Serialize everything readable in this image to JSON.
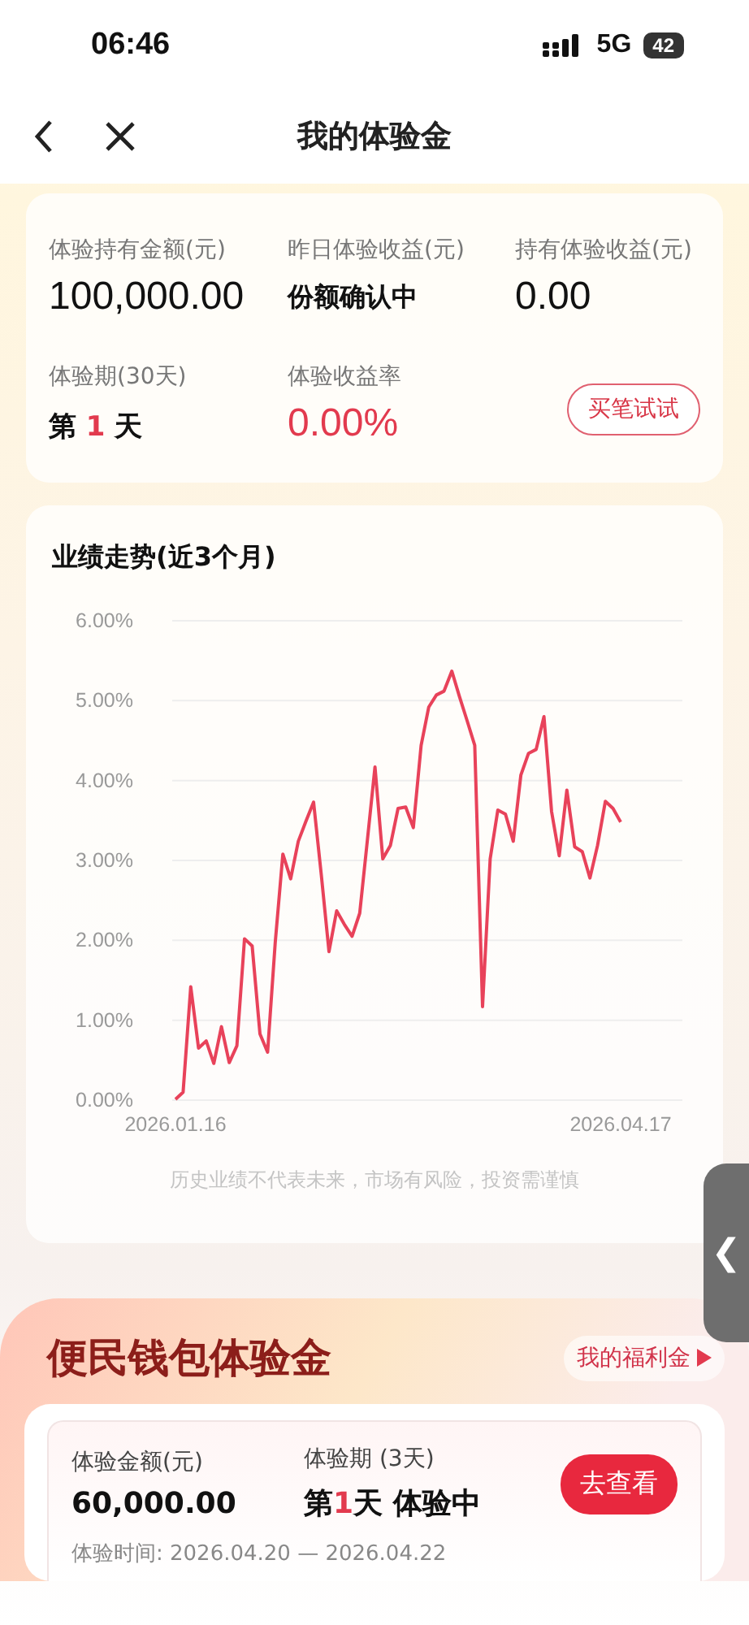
{
  "status_bar": {
    "time": "06:46",
    "network": "5G",
    "battery": "42"
  },
  "nav": {
    "title": "我的体验金"
  },
  "summary": {
    "stats": [
      {
        "label": "体验持有金额(元)",
        "value": "100,000.00",
        "kind": "amount"
      },
      {
        "label": "昨日体验收益(元)",
        "value": "份额确认中",
        "kind": "status"
      },
      {
        "label": "持有体验收益(元)",
        "value": "0.00",
        "kind": "amount"
      },
      {
        "label": "体验期(30天)",
        "value": {
          "prefix": "第",
          "number": "1",
          "suffix": "天"
        },
        "kind": "day"
      },
      {
        "label": "体验收益率",
        "value": "0.00%",
        "kind": "rate"
      }
    ],
    "button": "买笔试试"
  },
  "performance": {
    "title": "业绩走势(近3个月)",
    "chart_data": {
      "type": "line",
      "categories": [
        "2026.01.16",
        null,
        null,
        null,
        null,
        null,
        null,
        null,
        null,
        null,
        null,
        null,
        null,
        null,
        null,
        null,
        null,
        null,
        null,
        null,
        null,
        null,
        null,
        null,
        null,
        null,
        null,
        null,
        null,
        null,
        null,
        null,
        null,
        null,
        null,
        null,
        null,
        null,
        null,
        null,
        null,
        null,
        null,
        null,
        null,
        null,
        null,
        null,
        null,
        null,
        null,
        null,
        null,
        null,
        null,
        null,
        null,
        null,
        "2026.04.17"
      ],
      "series": [
        {
          "color": "#e8425a",
          "values": [
            0.01,
            0.1,
            1.42,
            0.65,
            0.74,
            0.46,
            0.92,
            0.47,
            0.68,
            2.02,
            1.93,
            0.83,
            0.6,
            1.97,
            3.08,
            2.77,
            3.24,
            3.49,
            3.73,
            2.81,
            1.86,
            2.37,
            2.2,
            2.05,
            2.34,
            3.25,
            4.17,
            3.02,
            3.19,
            3.65,
            3.67,
            3.41,
            4.44,
            4.92,
            5.07,
            5.12,
            5.37,
            5.05,
            4.75,
            4.44,
            1.17,
            3.02,
            3.63,
            3.58,
            3.24,
            4.07,
            4.34,
            4.39,
            4.8,
            3.61,
            3.06,
            3.88,
            3.17,
            3.11,
            2.78,
            3.19,
            3.74,
            3.65,
            3.48
          ]
        }
      ],
      "ylim": [
        0,
        6
      ],
      "grid": true,
      "yticks": [
        {
          "value": 0,
          "label": "0.00%"
        },
        {
          "value": 1,
          "label": "1.00%"
        },
        {
          "value": 2,
          "label": "2.00%"
        },
        {
          "value": 3,
          "label": "3.00%"
        },
        {
          "value": 4,
          "label": "4.00%"
        },
        {
          "value": 5,
          "label": "5.00%"
        },
        {
          "value": 6,
          "label": "6.00%"
        }
      ]
    },
    "disclaimer": "历史业绩不代表未来，市场有风险，投资需谨慎"
  },
  "side_tab": {
    "icon": "❮"
  },
  "wallet": {
    "title": "便民钱包体验金",
    "link": "我的福利金",
    "amount_label": "体验金额(元)",
    "amount": "60,000.00",
    "period_label": "体验期 (3天)",
    "day": {
      "prefix": "第",
      "number": "1",
      "suffix": "天"
    },
    "status": "体验中",
    "button": "去查看",
    "dates": "体验时间: 2026.04.20 — 2026.04.22"
  }
}
